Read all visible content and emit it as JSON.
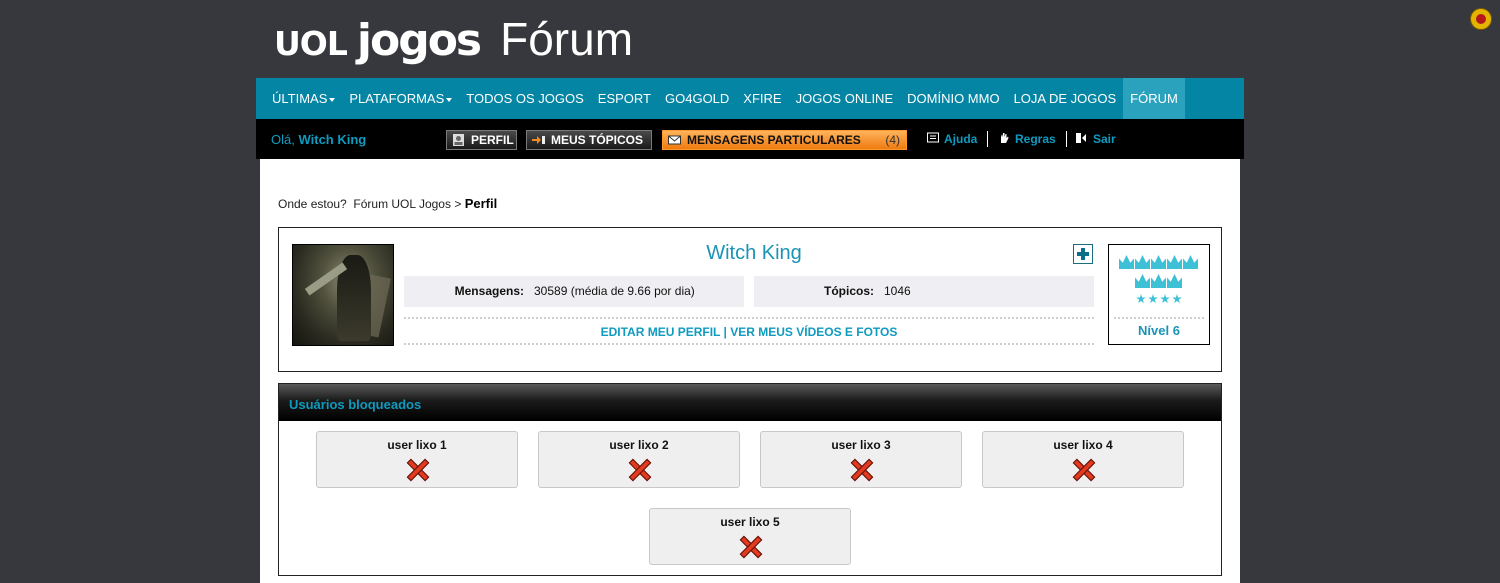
{
  "site": {
    "logo_uol": "UOL",
    "logo_jogos": "jogos",
    "logo_forum": "Fórum"
  },
  "nav": {
    "items": [
      {
        "label": "ÚLTIMAS",
        "dropdown": true
      },
      {
        "label": "PLATAFORMAS",
        "dropdown": true
      },
      {
        "label": "TODOS OS JOGOS",
        "dropdown": false
      },
      {
        "label": "ESPORT",
        "dropdown": false
      },
      {
        "label": "GO4GOLD",
        "dropdown": false
      },
      {
        "label": "XFIRE",
        "dropdown": false
      },
      {
        "label": "JOGOS ONLINE",
        "dropdown": false
      },
      {
        "label": "DOMÍNIO MMO",
        "dropdown": false
      },
      {
        "label": "LOJA DE JOGOS",
        "dropdown": false
      },
      {
        "label": "FÓRUM",
        "dropdown": false,
        "active": true
      }
    ]
  },
  "userbar": {
    "greeting_prefix": "Olá,",
    "username": "Witch King",
    "profile_btn": "PERFIL",
    "topics_btn": "MEUS TÓPICOS",
    "pm_btn": "MENSAGENS PARTICULARES",
    "pm_count": "(4)",
    "help": "Ajuda",
    "rules": "Regras",
    "logout": "Sair"
  },
  "breadcrumb": {
    "prefix": "Onde estou?",
    "forum": "Fórum UOL Jogos",
    "separator": ">",
    "current": "Perfil"
  },
  "profile": {
    "name": "Witch King",
    "messages_label": "Mensagens:",
    "messages_value": "30589 (média de 9.66 por dia)",
    "topics_label": "Tópicos:",
    "topics_value": "1046",
    "edit_link": "EDITAR MEU PERFIL",
    "link_sep": "|",
    "videos_link": "VER MEUS VÍDEOS E FOTOS",
    "level": "Nível 6",
    "crowns": 8,
    "stars": 4
  },
  "blocked": {
    "title": "Usuários bloqueados",
    "users": [
      "user lixo 1",
      "user lixo 2",
      "user lixo 3",
      "user lixo 4",
      "user lixo 5"
    ]
  },
  "colors": {
    "page_bg": "#37383d",
    "nav_bg": "#0585a4",
    "accent": "#0e9bc0",
    "pm_orange": "#f38a1e"
  }
}
